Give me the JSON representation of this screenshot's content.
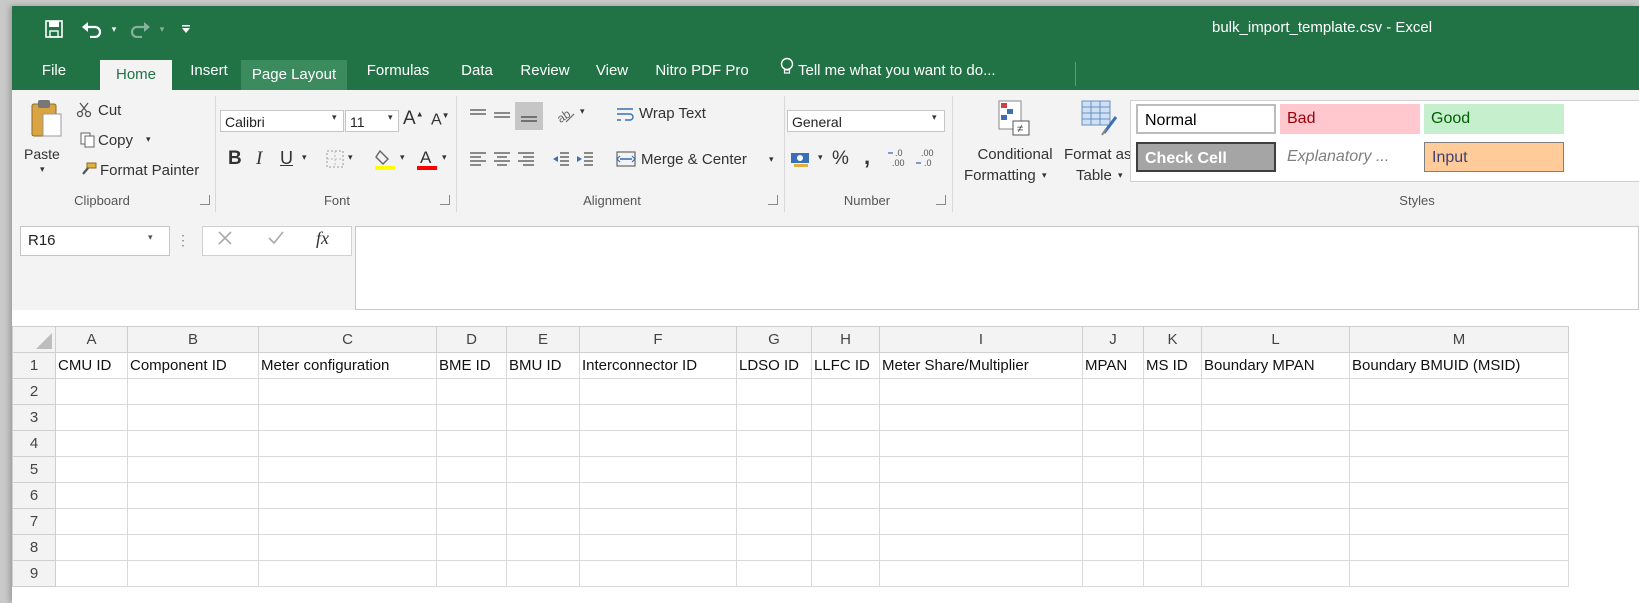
{
  "window": {
    "title": "bulk_import_template.csv - Excel"
  },
  "quick_access": {
    "save_icon": "save-icon",
    "undo_icon": "undo-icon",
    "redo_icon": "redo-icon",
    "customize_icon": "customize-qat-icon"
  },
  "tabs": [
    "File",
    "Home",
    "Insert",
    "Page Layout",
    "Formulas",
    "Data",
    "Review",
    "View",
    "Nitro PDF Pro"
  ],
  "tell_me": "Tell me what you want to do...",
  "ribbon": {
    "clipboard": {
      "paste": "Paste",
      "cut": "Cut",
      "copy": "Copy",
      "format_painter": "Format Painter",
      "label": "Clipboard"
    },
    "font": {
      "name": "Calibri",
      "size": "11",
      "bold": "B",
      "italic": "I",
      "underline": "U",
      "label": "Font"
    },
    "alignment": {
      "wrap_text": "Wrap Text",
      "merge_center": "Merge & Center",
      "label": "Alignment"
    },
    "number": {
      "format": "General",
      "percent": "%",
      "comma": ",",
      "label": "Number"
    },
    "styles": {
      "conditional_formatting_1": "Conditional",
      "conditional_formatting_2": "Formatting",
      "format_as_table_1": "Format as",
      "format_as_table_2": "Table",
      "normal": "Normal",
      "bad": "Bad",
      "good": "Good",
      "check_cell": "Check Cell",
      "explanatory": "Explanatory ...",
      "input": "Input",
      "label": "Styles"
    }
  },
  "formula_bar": {
    "name_box": "R16",
    "fx": "fx",
    "value": ""
  },
  "sheet": {
    "columns": [
      "A",
      "B",
      "C",
      "D",
      "E",
      "F",
      "G",
      "H",
      "I",
      "J",
      "K",
      "L",
      "M"
    ],
    "rows": [
      "1",
      "2",
      "3",
      "4",
      "5",
      "6",
      "7",
      "8",
      "9"
    ],
    "headers": [
      "CMU ID",
      "Component ID",
      "Meter configuration",
      "BME ID",
      "BMU ID",
      "Interconnector ID",
      "LDSO ID",
      "LLFC ID",
      "Meter Share/Multiplier",
      "MPAN",
      "MS ID",
      "Boundary MPAN",
      "Boundary BMUID (MSID)"
    ]
  },
  "colors": {
    "excel_green": "#217346",
    "bad_bg": "#ffc7ce",
    "bad_fg": "#9c0006",
    "good_bg": "#c6efce",
    "good_fg": "#006100",
    "input_bg": "#ffcc99",
    "input_fg": "#3f3f76",
    "check_bg": "#a5a5a5"
  }
}
